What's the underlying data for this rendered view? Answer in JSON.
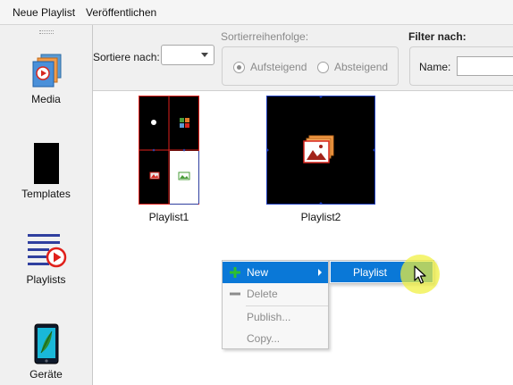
{
  "menubar": {
    "items": [
      {
        "label": "Neue Playlist"
      },
      {
        "label": "Veröffentlichen"
      }
    ]
  },
  "sidebar": {
    "items": [
      {
        "label": "Media",
        "icon": "media-icon"
      },
      {
        "label": "Templates",
        "icon": "template-icon"
      },
      {
        "label": "Playlists",
        "icon": "playlist-icon"
      },
      {
        "label": "Geräte",
        "icon": "device-icon"
      }
    ]
  },
  "toolbar": {
    "sort_label": "Sortiere nach:",
    "sort_value": "",
    "order_title": "Sortierreihenfolge:",
    "order_options": [
      {
        "label": "Aufsteigend",
        "selected": true
      },
      {
        "label": "Absteigend",
        "selected": false
      }
    ],
    "filter_title": "Filter nach:",
    "filter_name_label": "Name:",
    "filter_name_value": ""
  },
  "content": {
    "playlists": [
      {
        "caption": "Playlist1"
      },
      {
        "caption": "Playlist2"
      }
    ]
  },
  "context_menu": {
    "items": [
      {
        "label": "New",
        "state": "active",
        "icon": "plus-icon",
        "has_submenu": true
      },
      {
        "label": "Delete",
        "state": "disabled",
        "icon": "minus-icon"
      },
      {
        "label": "Publish...",
        "state": "disabled"
      },
      {
        "label": "Copy...",
        "state": "disabled"
      }
    ],
    "submenu": {
      "items": [
        {
          "label": "Playlist",
          "state": "active"
        }
      ]
    }
  },
  "colors": {
    "accent": "#0a78d7",
    "selection_border": "#1f3fbf",
    "playlist_red": "#e0201b",
    "cursor_halo": "#f0f03c"
  }
}
